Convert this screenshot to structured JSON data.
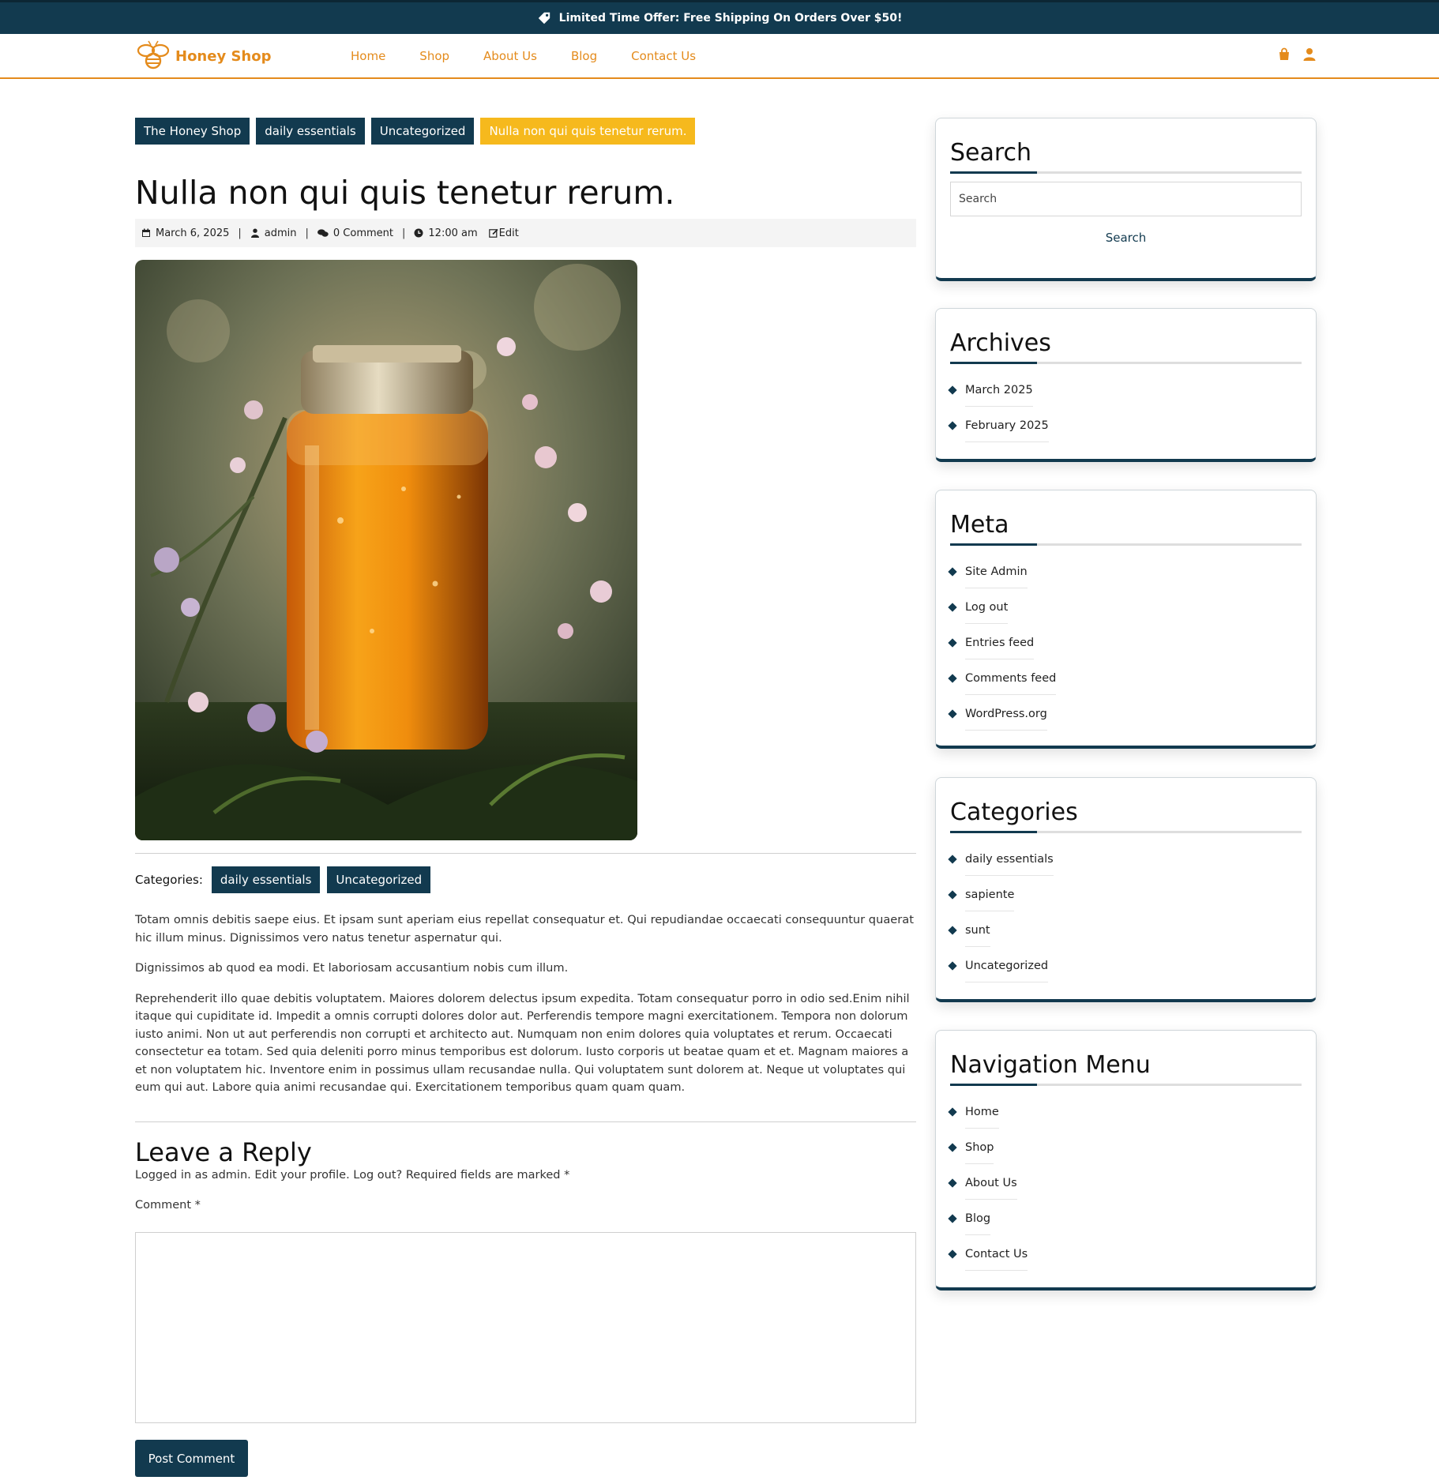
{
  "topbar": {
    "offer": "Limited Time Offer: Free Shipping On Orders Over $50!"
  },
  "header": {
    "logo_text": "Honey Shop",
    "nav": [
      "Home",
      "Shop",
      "About Us",
      "Blog",
      "Contact Us"
    ]
  },
  "breadcrumb": [
    "The Honey Shop",
    "daily essentials",
    "Uncategorized",
    "Nulla non qui quis tenetur rerum."
  ],
  "post": {
    "title": "Nulla non qui quis tenetur rerum.",
    "date": "March 6, 2025",
    "author": "admin",
    "comments": "0 Comment",
    "time": "12:00 am",
    "edit": "Edit",
    "categories_label": "Categories:",
    "categories": [
      "daily essentials",
      "Uncategorized"
    ],
    "paragraphs": [
      "Totam omnis debitis saepe eius. Et ipsam sunt aperiam eius repellat consequatur et. Qui repudiandae occaecati consequuntur quaerat hic illum minus. Dignissimos vero natus tenetur aspernatur qui.",
      "Dignissimos ab quod ea modi. Et laboriosam accusantium nobis cum illum.",
      "Reprehenderit illo quae debitis voluptatem. Maiores dolorem delectus ipsum expedita. Totam consequatur porro in odio sed.Enim nihil itaque qui cupiditate id. Impedit a omnis corrupti dolores dolor aut. Perferendis tempore magni exercitationem. Tempora non dolorum iusto animi. Non ut aut perferendis non corrupti et architecto aut. Numquam non enim dolores quia voluptates et rerum. Occaecati consectetur ea totam. Sed quia deleniti porro minus temporibus est dolorum. Iusto corporis ut beatae quam et et. Magnam maiores a et non voluptatem hic. Inventore enim in possimus ullam recusandae nulla. Qui voluptatem sunt dolorem at. Neque ut voluptates qui eum qui aut. Labore quia animi recusandae qui. Exercitationem temporibus quam quam quam."
    ]
  },
  "reply": {
    "title": "Leave a Reply",
    "logged_prefix": "Logged in as admin. ",
    "edit_profile": "Edit your profile.",
    "logout": "Log out?",
    "required": " Required fields are marked *",
    "comment_label": "Comment *",
    "submit": "Post Comment"
  },
  "sidebar": {
    "search": {
      "title": "Search",
      "placeholder": "Search",
      "button": "Search"
    },
    "archives": {
      "title": "Archives",
      "items": [
        "March 2025",
        "February 2025"
      ]
    },
    "meta": {
      "title": "Meta",
      "items": [
        "Site Admin",
        "Log out",
        "Entries feed",
        "Comments feed",
        "WordPress.org"
      ]
    },
    "categories": {
      "title": "Categories",
      "items": [
        "daily essentials",
        "sapiente",
        "sunt",
        "Uncategorized"
      ]
    },
    "navigation": {
      "title": "Navigation Menu",
      "items": [
        "Home",
        "Shop",
        "About Us",
        "Blog",
        "Contact Us"
      ]
    }
  },
  "colors": {
    "primary": "#123a4f",
    "accent": "#e48b1c",
    "highlight": "#f6b91d"
  },
  "icons": [
    "tag-icon",
    "bee-logo-icon",
    "shopping-bag-icon",
    "user-icon",
    "calendar-icon",
    "author-icon",
    "comments-icon",
    "clock-icon",
    "edit-icon",
    "diamond-bullet-icon"
  ]
}
